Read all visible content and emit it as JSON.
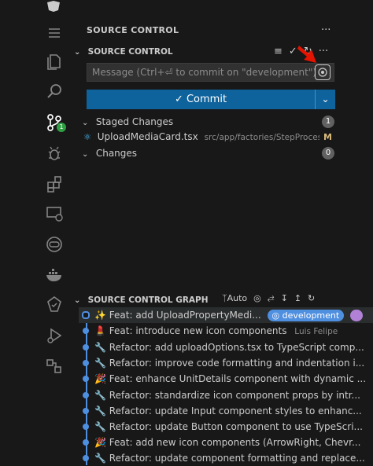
{
  "view": {
    "title": "SOURCE CONTROL",
    "more": "···"
  },
  "source_control": {
    "header": "SOURCE CONTROL",
    "message_placeholder": "Message (Ctrl+⏎ to commit on \"development\")",
    "commit_button": "Commit",
    "commit_icon": "check-icon",
    "staged": {
      "label": "Staged Changes",
      "count": "1",
      "files": [
        {
          "name": "UploadMediaCard.tsx",
          "path": "src/app/factories/StepProcess/c...",
          "status": "M"
        }
      ]
    },
    "changes": {
      "label": "Changes",
      "count": "0"
    }
  },
  "graph": {
    "header": "SOURCE CONTROL GRAPH",
    "auto_label": "Auto",
    "commits": [
      {
        "emoji": "✨",
        "message": "Feat: add UploadPropertyMedi...",
        "branch": "development",
        "author": ""
      },
      {
        "emoji": "💄",
        "message": "Feat: introduce new icon components",
        "branch": "",
        "author": "Luis Felipe"
      },
      {
        "emoji": "🔧",
        "message": "Refactor: add uploadOptions.tsx to TypeScript comp...",
        "branch": "",
        "author": ""
      },
      {
        "emoji": "🔧",
        "message": "Refactor: improve code formatting and indentation i...",
        "branch": "",
        "author": ""
      },
      {
        "emoji": "🎉",
        "message": "Feat: enhance UnitDetails component with dynamic ...",
        "branch": "",
        "author": ""
      },
      {
        "emoji": "🔧",
        "message": "Refactor: standardize icon component props by intr...",
        "branch": "",
        "author": ""
      },
      {
        "emoji": "🔧",
        "message": "Refactor: update Input component styles to enhanc...",
        "branch": "",
        "author": ""
      },
      {
        "emoji": "🔧",
        "message": "Refactor: update Button component to use TypeScri...",
        "branch": "",
        "author": ""
      },
      {
        "emoji": "🎉",
        "message": "Feat: add new icon components (ArrowRight, Chevr...",
        "branch": "",
        "author": ""
      },
      {
        "emoji": "🔧",
        "message": "Refactor: update component formatting and replace...",
        "branch": "",
        "author": ""
      }
    ]
  },
  "activity_badge": "1",
  "colors": {
    "accent": "#0e639c",
    "graph": "#4f8fe0",
    "modified": "#d7ba7d",
    "badge": "#2ea043",
    "arrow": "#e51400"
  }
}
